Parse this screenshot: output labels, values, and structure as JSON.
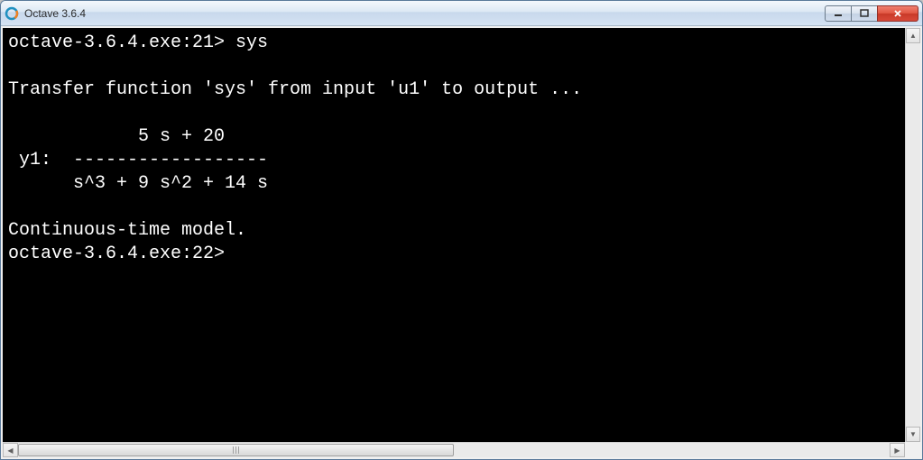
{
  "window": {
    "title": "Octave 3.6.4"
  },
  "terminal": {
    "line1": "octave-3.6.4.exe:21> sys",
    "line2": "",
    "line3": "Transfer function 'sys' from input 'u1' to output ...",
    "line4": "",
    "line5": "            5 s + 20",
    "line6": " y1:  ------------------",
    "line7": "      s^3 + 9 s^2 + 14 s",
    "line8": "",
    "line9": "Continuous-time model.",
    "line10": "octave-3.6.4.exe:22>"
  }
}
